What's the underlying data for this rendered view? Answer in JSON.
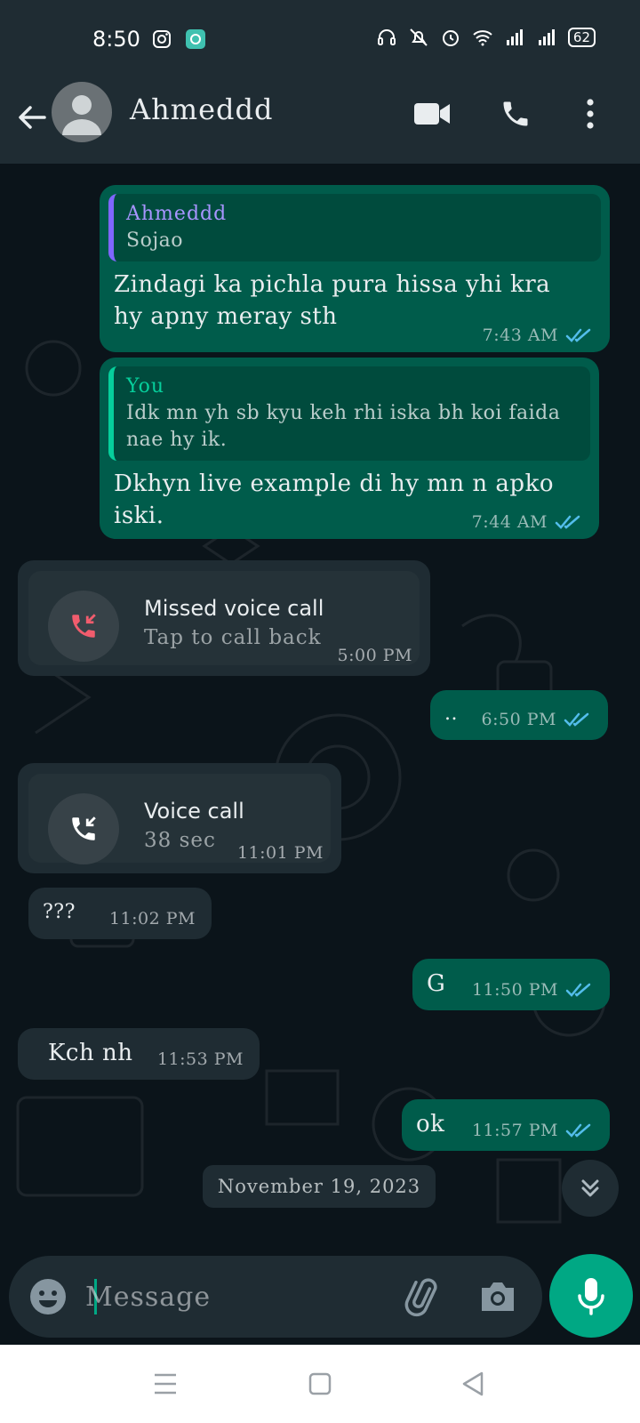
{
  "status": {
    "time": "8:50",
    "battery": "62"
  },
  "header": {
    "contact_name": "Ahmeddd"
  },
  "messages": {
    "m1": {
      "quote_author": "Ahmeddd",
      "quote_text": "Sojao",
      "text": "Zindagi ka pichla pura hissa yhi kra hy apny meray sth",
      "time": "7:43 AM"
    },
    "m2": {
      "quote_author": "You",
      "quote_text": "Idk mn yh sb kyu keh rhi iska bh koi faida nae hy ik.",
      "text": "Dkhyn live example di hy mn n apko iski.",
      "time": "7:44 AM"
    },
    "m3": {
      "title": "Missed voice call",
      "subtitle": "Tap to call back",
      "time": "5:00 PM"
    },
    "m4": {
      "text": "..",
      "time": "6:50 PM"
    },
    "m5": {
      "title": "Voice call",
      "subtitle": "38 sec",
      "time": "11:01 PM"
    },
    "m6": {
      "text": "???",
      "time": "11:02 PM"
    },
    "m7": {
      "text": "G",
      "time": "11:50 PM"
    },
    "m8": {
      "text": "Kch nh",
      "time": "11:53 PM"
    },
    "m9": {
      "text": "ok",
      "time": "11:57 PM"
    }
  },
  "date_chip": "November 19, 2023",
  "input": {
    "placeholder": "Message"
  },
  "colors": {
    "accent": "#00a884",
    "outgoing": "#005c4b",
    "incoming": "#1f2c33",
    "background": "#0b141a",
    "missed": "#f15c6d",
    "read_tick": "#53bdeb"
  }
}
